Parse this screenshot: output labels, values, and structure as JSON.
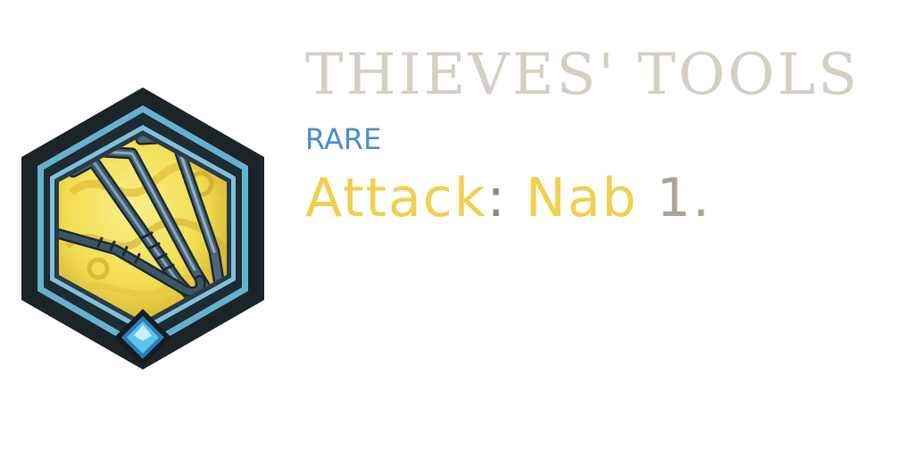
{
  "item": {
    "name": "THIEVES' TOOLS",
    "rarity": "RARE",
    "effect": {
      "keyword": "Attack",
      "separator": ":",
      "ability": "Nab",
      "value": "1."
    },
    "icon": "thieves-tools-icon",
    "gem_icon": "diamond-gem-icon"
  },
  "colors": {
    "name": "#d4cfc3",
    "rarity": "#4a8ed0",
    "keyword": "#f1cf4f",
    "separator": "#8a8a80",
    "value": "#aaa597",
    "frame_outer": "#1d2428",
    "frame_blue": "#62b1d3",
    "art_background": "#f2dd52",
    "gem": "#5cc4f2"
  }
}
